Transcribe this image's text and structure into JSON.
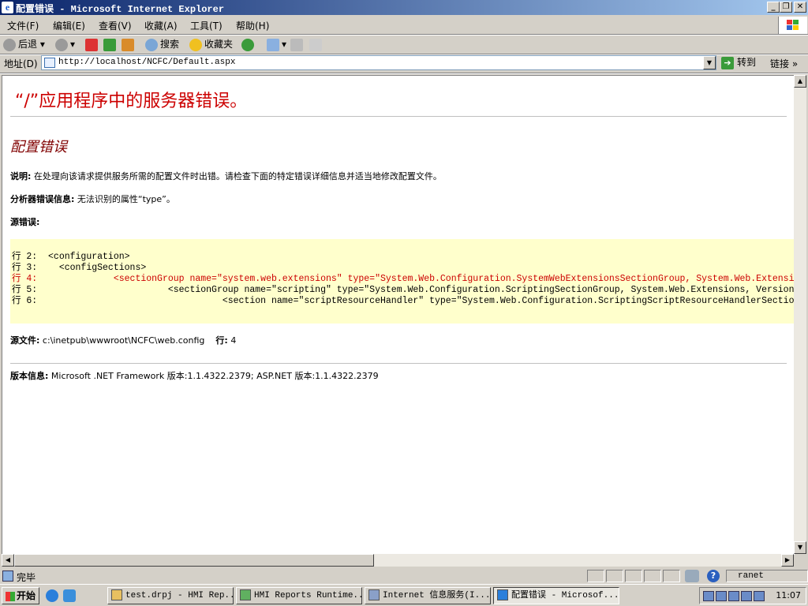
{
  "window": {
    "title": "配置错误 - Microsoft Internet Explorer",
    "icon_letter": "e"
  },
  "menubar": {
    "items": [
      "文件(F)",
      "编辑(E)",
      "查看(V)",
      "收藏(A)",
      "工具(T)",
      "帮助(H)"
    ]
  },
  "toolbar": {
    "back_label": "后退",
    "search_label": "搜索",
    "favorites_label": "收藏夹"
  },
  "address": {
    "label": "地址(D)",
    "url": "http://localhost/NCFC/Default.aspx",
    "go_label": "转到",
    "links_label": "链接"
  },
  "page": {
    "heading": "“/”应用程序中的服务器错误。",
    "subheading": "配置错误",
    "description_label": "说明:",
    "description_text": "在处理向该请求提供服务所需的配置文件时出错。请检查下面的特定错误详细信息并适当地修改配置文件。",
    "parser_label": "分析器错误信息:",
    "parser_text": "无法识别的属性“type”。",
    "source_label": "源错误:",
    "code_lines": [
      {
        "num": "行 2:",
        "code": "  <configuration>",
        "error": false
      },
      {
        "num": "行 3:",
        "code": "    <configSections>",
        "error": false
      },
      {
        "num": "行 4:",
        "code": "              <sectionGroup name=\"system.web.extensions\" type=\"System.Web.Configuration.SystemWebExtensionsSectionGroup, System.Web.Extensions",
        "error": true
      },
      {
        "num": "行 5:",
        "code": "                        <sectionGroup name=\"scripting\" type=\"System.Web.Configuration.ScriptingSectionGroup, System.Web.Extensions, Version=",
        "error": false
      },
      {
        "num": "行 6:",
        "code": "                                  <section name=\"scriptResourceHandler\" type=\"System.Web.Configuration.ScriptingScriptResourceHandlerSection",
        "error": false
      }
    ],
    "source_file_label": "源文件:",
    "source_file": "c:\\inetpub\\wwwroot\\NCFC\\web.config",
    "line_label": "行:",
    "line_value": "4",
    "version_label": "版本信息:",
    "version_text": "Microsoft .NET Framework 版本:1.1.4322.2379; ASP.NET 版本:1.1.4322.2379"
  },
  "statusbar": {
    "text": "完毕",
    "zone": "ranet"
  },
  "taskbar": {
    "start_label": "开始",
    "tasks": [
      {
        "label": "test.drpj - HMI Rep...",
        "active": false
      },
      {
        "label": "HMI Reports Runtime...",
        "active": false
      },
      {
        "label": "Internet 信息服务(I...",
        "active": false
      },
      {
        "label": "配置错误 - Microsof...",
        "active": true
      }
    ],
    "clock": "11:07"
  }
}
